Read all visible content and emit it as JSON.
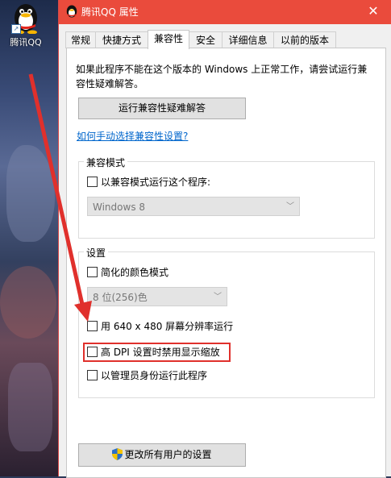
{
  "desktop": {
    "icon_label": "腾讯QQ"
  },
  "window": {
    "title": "腾讯QQ 属性",
    "close_glyph": "✕"
  },
  "tabs": [
    {
      "label": "常规"
    },
    {
      "label": "快捷方式"
    },
    {
      "label": "兼容性",
      "active": true
    },
    {
      "label": "安全"
    },
    {
      "label": "详细信息"
    },
    {
      "label": "以前的版本"
    }
  ],
  "compat": {
    "intro": "如果此程序不能在这个版本的 Windows 上正常工作，请尝试运行兼容性疑难解答。",
    "troubleshoot_button": "运行兼容性疑难解答",
    "manual_link": "如何手动选择兼容性设置?",
    "mode_group_title": "兼容模式",
    "mode_checkbox": "以兼容模式运行这个程序:",
    "mode_select_value": "Windows 8",
    "settings_group_title": "设置",
    "reduced_color_checkbox": "简化的颜色模式",
    "color_select_value": "8 位(256)色",
    "res640_checkbox": "用 640 x 480 屏幕分辨率运行",
    "dpi_checkbox": "高 DPI 设置时禁用显示缩放",
    "admin_checkbox": "以管理员身份运行此程序",
    "all_users_button": "更改所有用户的设置"
  },
  "colors": {
    "titlebar": "#ea4b3c",
    "highlight": "#e0302c",
    "link": "#0066cc"
  }
}
